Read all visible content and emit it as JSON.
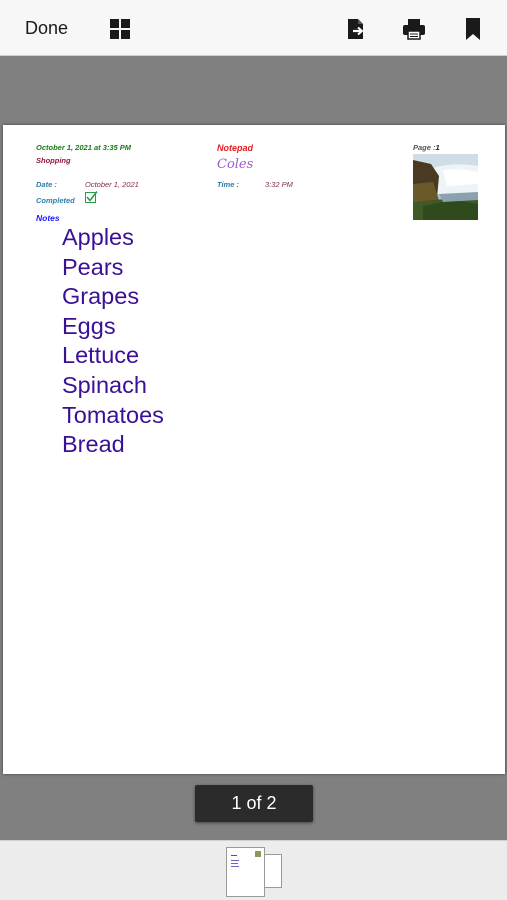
{
  "toolbar": {
    "done_label": "Done",
    "icons": [
      "grid-icon",
      "export-icon",
      "print-icon",
      "bookmark-icon"
    ]
  },
  "note": {
    "header_date": "October 1, 2021 at 3:35 PM",
    "category": "Shopping",
    "app_name": "Notepad",
    "store": "Coles",
    "date_label": "Date  :",
    "date_value": "October 1, 2021",
    "time_label": "Time  :",
    "time_value": "3:32 PM",
    "completed_label": "Completed",
    "completed": true,
    "page_label": "Page  :",
    "page_number": "1",
    "notes_label": "Notes",
    "items": [
      "Apples",
      "Pears",
      "Grapes",
      "Eggs",
      "Lettuce",
      "Spinach",
      "Tomatoes",
      "Bread"
    ]
  },
  "pager": {
    "text": "1 of 2"
  },
  "colors": {
    "toolbar_bg": "#f7f7f7",
    "viewer_bg": "#808080",
    "item_text": "#3a1096",
    "header_date": "#1a7a1a",
    "app_name": "#e61e1e",
    "notes_label": "#1a1aff"
  }
}
